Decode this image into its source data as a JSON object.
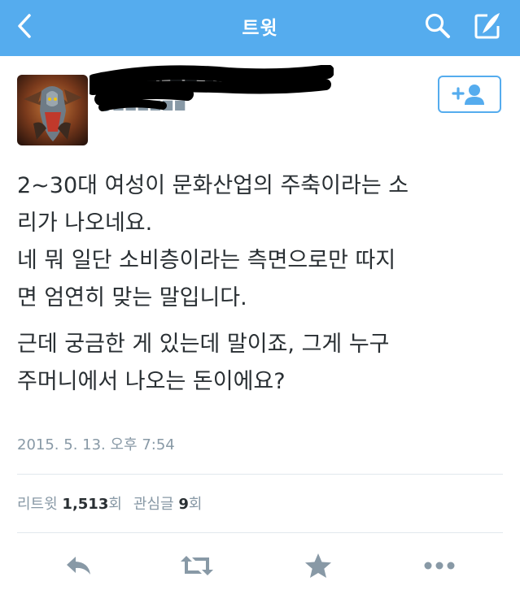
{
  "navbar": {
    "title": "트윗",
    "back_icon": "chevron-left-icon",
    "search_icon": "search-icon",
    "compose_icon": "compose-icon",
    "color": "#55acee"
  },
  "tweet": {
    "display_name": "■■■■, ■■ Blackwind",
    "handle": "@■■■■■■",
    "lines": [
      "2~30대 여성이 문화산업의 주축이라는 소",
      "리가 나오네요.",
      "네 뭐 일단 소비층이라는 측면으로만 따지",
      "면 엄연히 맞는 말입니다.",
      "근데 궁금한 게 있는데 말이죠, 그게 누구",
      "주머니에서 나오는 돈이에요?"
    ],
    "timestamp": "2015. 5. 13. 오후 7:54"
  },
  "stats": {
    "retweet_label": "리트윗",
    "retweet_count": "1,513",
    "retweet_unit": "회",
    "favorite_label": "관심글",
    "favorite_count": "9",
    "favorite_unit": "회"
  },
  "actions": [
    "reply-icon",
    "retweet-icon",
    "favorite-star-icon",
    "more-icon"
  ]
}
